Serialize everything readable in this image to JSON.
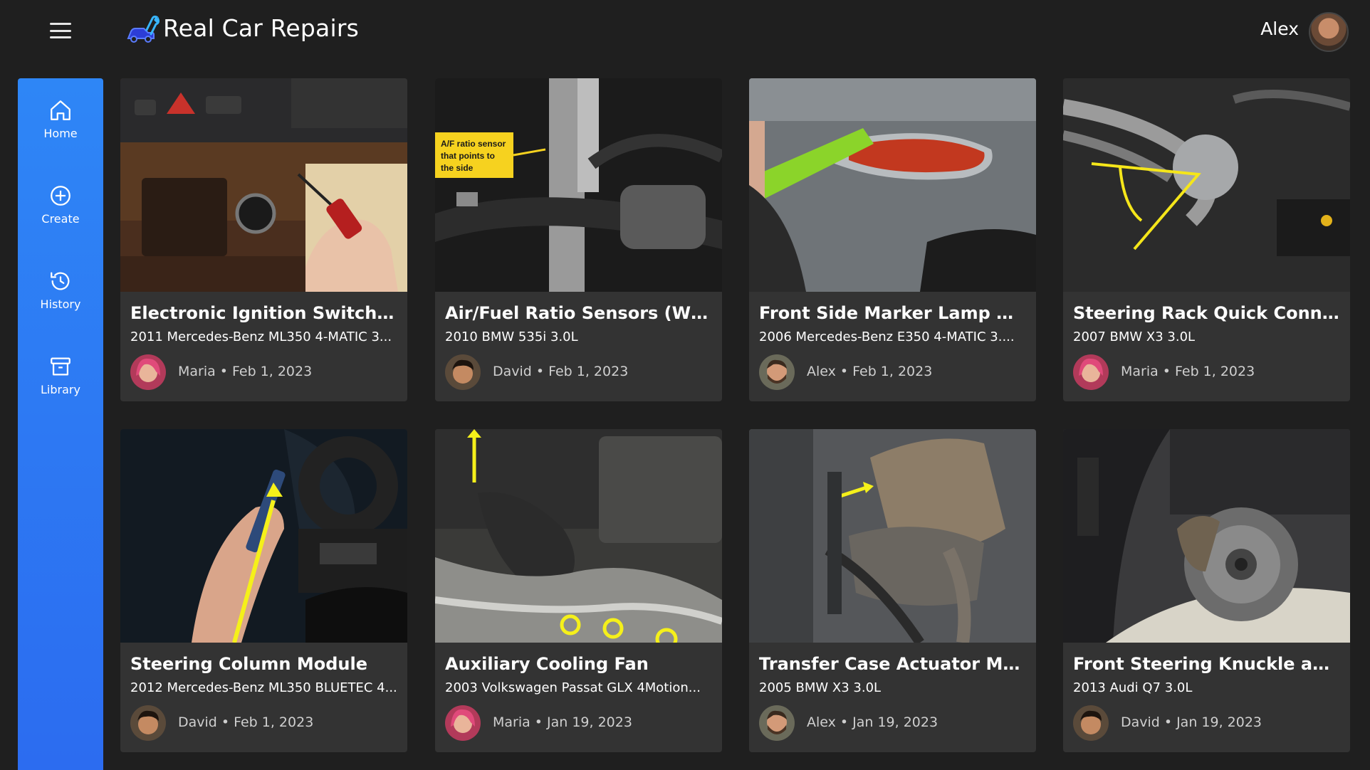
{
  "app": {
    "title": "Real Car Repairs",
    "user": "Alex"
  },
  "sidebar": {
    "items": [
      {
        "label": "Home",
        "icon": "home-icon"
      },
      {
        "label": "Create",
        "icon": "plus-circle-icon"
      },
      {
        "label": "History",
        "icon": "history-icon"
      },
      {
        "label": "Library",
        "icon": "archive-icon"
      }
    ]
  },
  "colors": {
    "sidebar": "#2c7bf5",
    "card": "#333333",
    "background": "#1f1f1f"
  },
  "cards": [
    {
      "title": "Electronic Ignition Switch (EIS...",
      "vehicle": "2011 Mercedes-Benz ML350 4-MATIC 3...",
      "author": "Maria",
      "date": "Feb 1, 2023"
    },
    {
      "title": "Air/Fuel Ratio Sensors (Wide ...",
      "vehicle": "2010 BMW 535i 3.0L",
      "author": "David",
      "date": "Feb 1, 2023",
      "overlay_text": [
        "A/F ratio sensor",
        "that points to",
        "the side"
      ]
    },
    {
      "title": "Front Side Marker Lamp Repl...",
      "vehicle": "2006 Mercedes-Benz E350 4-MATIC 3....",
      "author": "Alex",
      "date": "Feb 1, 2023"
    },
    {
      "title": "Steering Rack Quick Connect...",
      "vehicle": "2007 BMW X3 3.0L",
      "author": "Maria",
      "date": "Feb 1, 2023"
    },
    {
      "title": "Steering Column Module",
      "vehicle": "2012 Mercedes-Benz ML350 BLUETEC 4...",
      "author": "David",
      "date": "Feb 1, 2023"
    },
    {
      "title": "Auxiliary Cooling Fan",
      "vehicle": "2003 Volkswagen Passat GLX 4Motion...",
      "author": "Maria",
      "date": "Jan 19, 2023"
    },
    {
      "title": "Transfer Case Actuator Motor",
      "vehicle": "2005 BMW X3 3.0L",
      "author": "Alex",
      "date": "Jan 19, 2023"
    },
    {
      "title": "Front Steering Knuckle and W...",
      "vehicle": "2013 Audi Q7 3.0L",
      "author": "David",
      "date": "Jan 19, 2023"
    }
  ]
}
